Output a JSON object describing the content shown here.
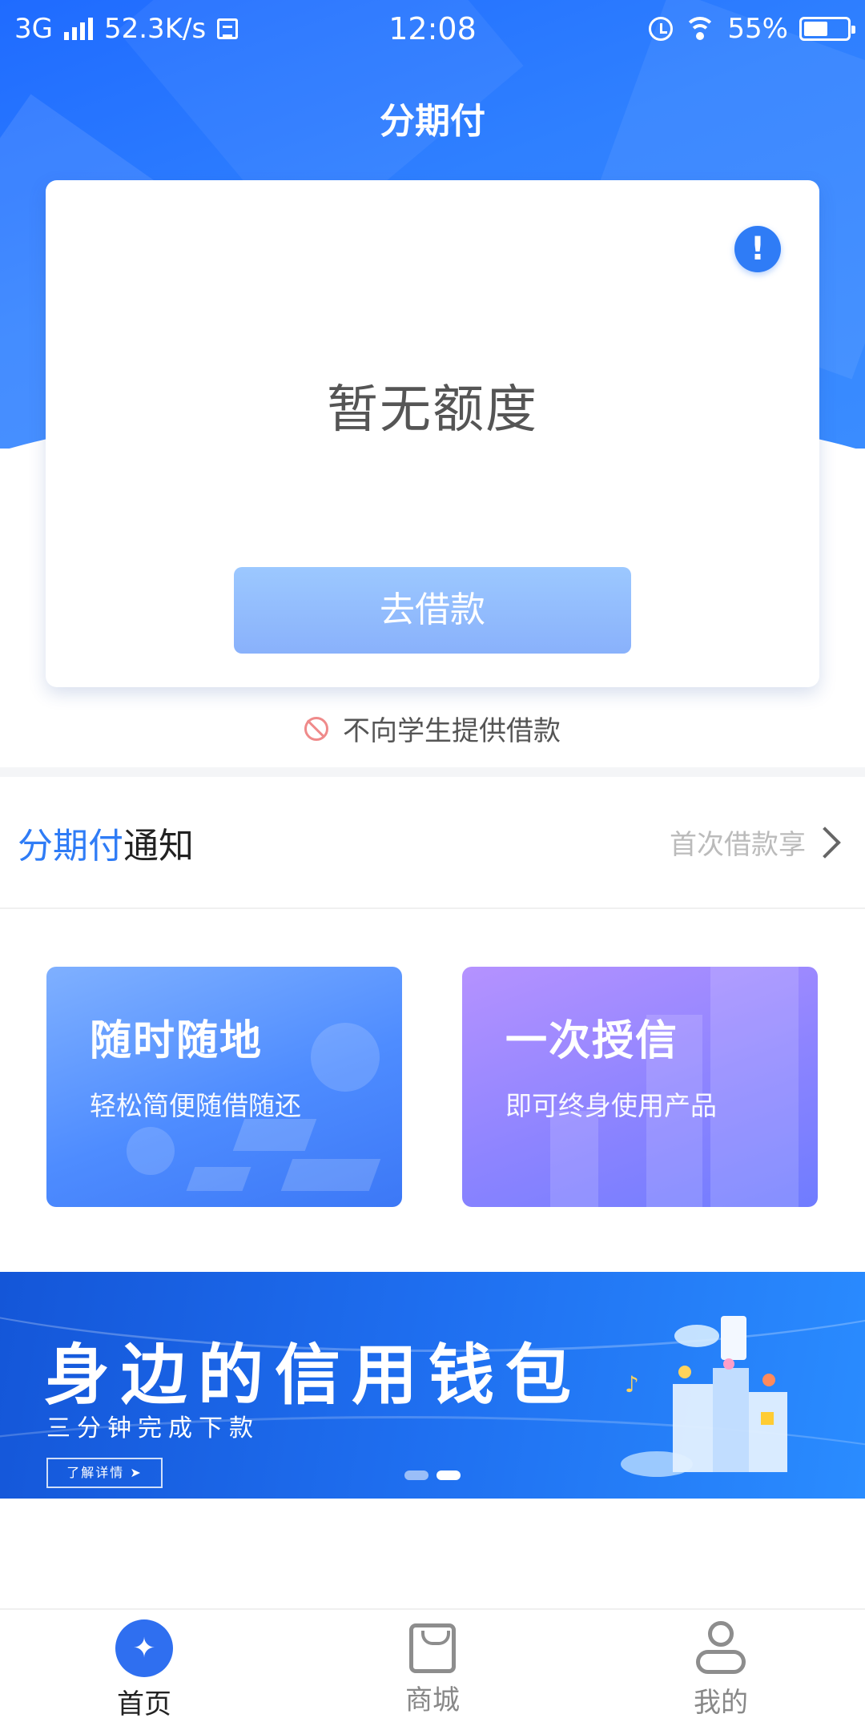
{
  "status_bar": {
    "network": "3G",
    "speed": "52.3K/s",
    "time": "12:08",
    "battery": "55%",
    "battery_level": 0.55
  },
  "header": {
    "title": "分期付"
  },
  "credit": {
    "quota_text": "暂无额度",
    "borrow_button": "去借款",
    "student_note": "不向学生提供借款"
  },
  "notice": {
    "title_highlight": "分期付",
    "title_rest": "通知",
    "message": "首次借款享"
  },
  "features": [
    {
      "title": "随时随地",
      "subtitle": "轻松简便随借随还"
    },
    {
      "title": "一次授信",
      "subtitle": "即可终身使用产品"
    }
  ],
  "banner": {
    "title": "身边的信用钱包",
    "subtitle": "三分钟完成下款",
    "button": "了解详情 ➤",
    "current_slide": 2,
    "total_slides": 2
  },
  "bottom_nav": [
    {
      "label": "首页",
      "icon": "home-icon",
      "active": true
    },
    {
      "label": "商城",
      "icon": "shopping-bag-icon",
      "active": false
    },
    {
      "label": "我的",
      "icon": "user-icon",
      "active": false
    }
  ],
  "colors": {
    "primary": "#2f7cf6",
    "header_bg": "#2f80ff",
    "button_bg": "#89b1fb",
    "warning": "#ef8a8a"
  }
}
